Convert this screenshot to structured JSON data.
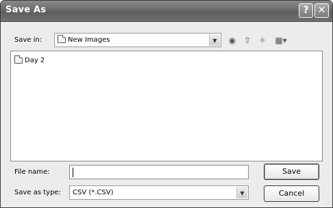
{
  "dialog": {
    "title": "Save As",
    "help_glyph": "?",
    "close_glyph": "✕",
    "save_in_label": "Save in:",
    "save_in_value": "New Images",
    "toolbar": {
      "back_icon": "back-icon",
      "up_icon": "up-folder-icon",
      "new_folder_icon": "new-folder-icon",
      "views_icon": "views-menu-icon"
    },
    "files": [
      {
        "name": "Day 2",
        "icon": "folder-icon"
      }
    ],
    "file_name_label": "File name:",
    "file_name_value": "",
    "save_as_type_label": "Save as type:",
    "save_as_type_value": "CSV (*.CSV)",
    "save_button": "Save",
    "cancel_button": "Cancel"
  }
}
